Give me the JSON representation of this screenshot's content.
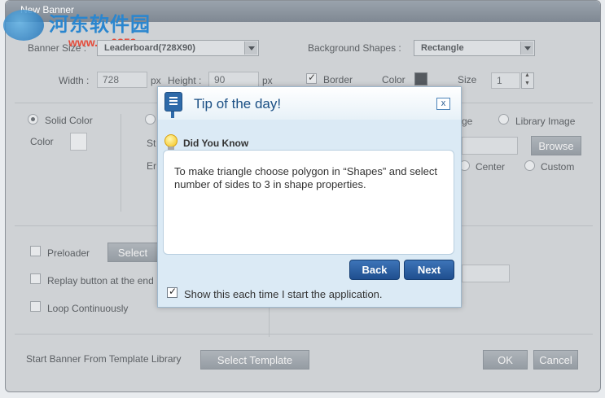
{
  "window": {
    "title": "New Banner"
  },
  "watermark": {
    "text": "河东软件园",
    "url": "www.pc0359.cn"
  },
  "banner": {
    "size_label": "Banner Size :",
    "size_value": "Leaderboard(728X90)",
    "bg_shapes_label": "Background Shapes :",
    "bg_shapes_value": "Rectangle",
    "width_label": "Width :",
    "width_value": "728",
    "width_unit": "px",
    "height_label": "Height :",
    "height_value": "90",
    "height_unit": "px",
    "border_label": "Border",
    "border_checked": true,
    "color_label": "Color",
    "border_color": "#555a5f",
    "size2_label": "Size",
    "size2_value": "1"
  },
  "fill": {
    "solid_label": "Solid Color",
    "color_label": "Color",
    "st_label": "St",
    "er_label": "Er",
    "image_partial_label": "ge",
    "library_image_label": "Library Image",
    "browse_label": "Browse",
    "center_label": "Center",
    "custom_label": "Custom"
  },
  "options": {
    "preloader_label": "Preloader",
    "select_label": "Select",
    "replay_label": "Replay button at the end",
    "loop_label": "Loop Continuously"
  },
  "footer": {
    "template_label": "Start Banner From Template Library",
    "select_template_label": "Select Template",
    "ok_label": "OK",
    "cancel_label": "Cancel"
  },
  "tip": {
    "title": "Tip of the day!",
    "close_label": "x",
    "heading": "Did You Know",
    "body": "To make triangle choose polygon in “Shapes” and select number of sides to 3 in shape properties.",
    "back_label": "Back",
    "next_label": "Next",
    "show_label": "Show this each time I start the application.",
    "show_checked": true
  },
  "colors": {
    "tip_title": "#1a4f84",
    "button_blue": "#2a5f9f"
  }
}
